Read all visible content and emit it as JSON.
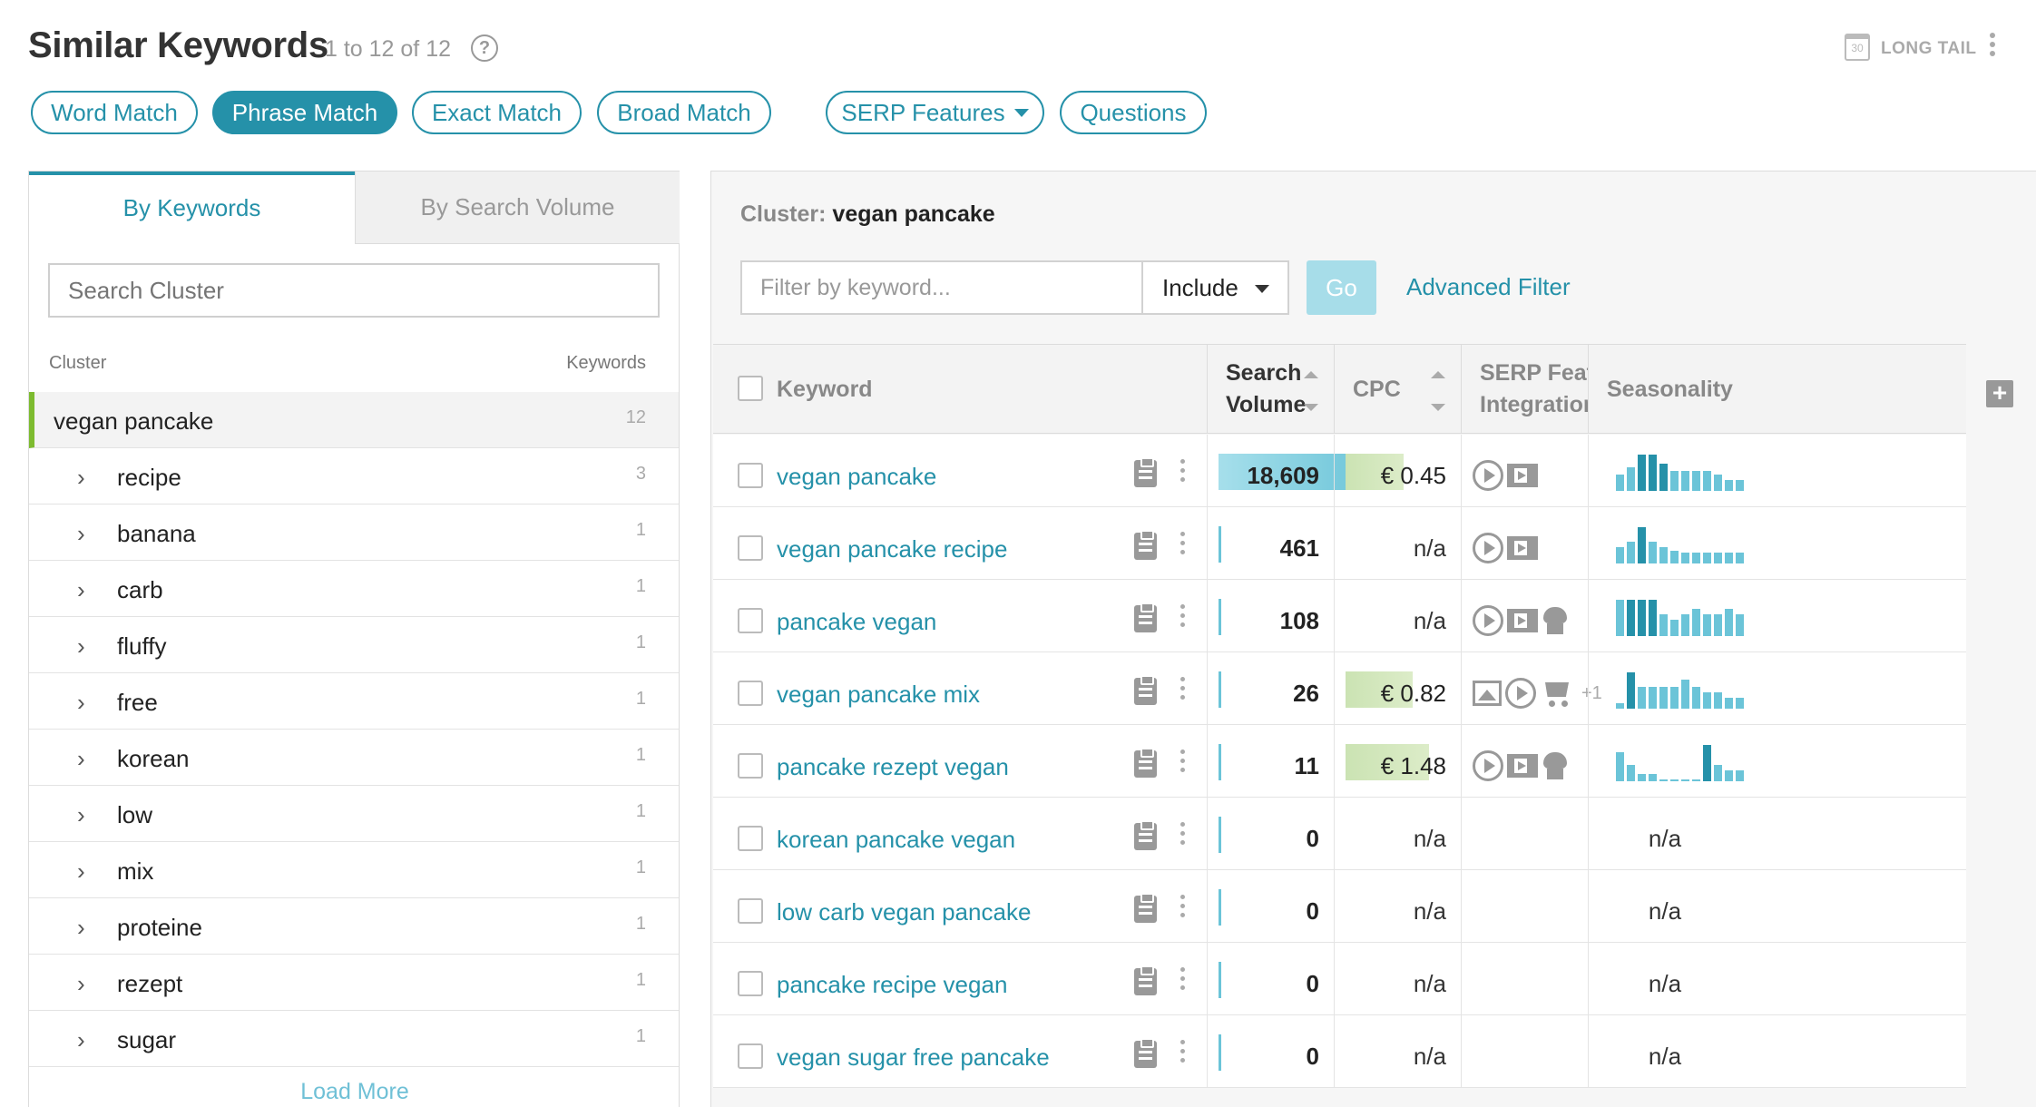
{
  "header": {
    "title": "Similar Keywords",
    "count": "1 to 12 of 12",
    "help": "?",
    "calendar_day": "30",
    "long_tail": "LONG TAIL"
  },
  "match_tabs": [
    "Word Match",
    "Phrase Match",
    "Exact Match",
    "Broad Match"
  ],
  "active_match": "Phrase Match",
  "filter_tabs": [
    "SERP Features",
    "Questions"
  ],
  "left_panel": {
    "tabs": [
      "By Keywords",
      "By Search Volume"
    ],
    "active_tab": "By Keywords",
    "search_placeholder": "Search Cluster",
    "col_cluster": "Cluster",
    "col_keywords": "Keywords",
    "main_cluster": {
      "label": "vegan pancake",
      "count": "12"
    },
    "subclusters": [
      {
        "label": "recipe",
        "count": "3"
      },
      {
        "label": "banana",
        "count": "1"
      },
      {
        "label": "carb",
        "count": "1"
      },
      {
        "label": "fluffy",
        "count": "1"
      },
      {
        "label": "free",
        "count": "1"
      },
      {
        "label": "korean",
        "count": "1"
      },
      {
        "label": "low",
        "count": "1"
      },
      {
        "label": "mix",
        "count": "1"
      },
      {
        "label": "proteine",
        "count": "1"
      },
      {
        "label": "rezept",
        "count": "1"
      },
      {
        "label": "sugar",
        "count": "1"
      }
    ],
    "load_more": "Load More"
  },
  "right_panel": {
    "cluster_label": "Cluster:",
    "cluster_name": "vegan pancake",
    "filter_placeholder": "Filter by keyword...",
    "include_value": "Include",
    "go": "Go",
    "advanced_filter": "Advanced Filter",
    "columns": {
      "keyword": "Keyword",
      "search_volume_1": "Search",
      "search_volume_2": "Volume",
      "cpc": "CPC",
      "serp_1": "SERP Feature",
      "serp_2": "Integrations",
      "seasonality": "Seasonality",
      "add": "+"
    },
    "rows": [
      {
        "keyword": "vegan pancake",
        "volume": "18,609",
        "volume_fraction": 1.0,
        "cpc": "€ 0.45",
        "cpc_fraction": 0.3,
        "serp": [
          "play-icon",
          "video-icon"
        ],
        "season": [
          0.45,
          0.65,
          1.0,
          1.0,
          0.75,
          0.55,
          0.55,
          0.55,
          0.55,
          0.45,
          0.3,
          0.3
        ],
        "season_max": [
          2,
          3,
          4
        ]
      },
      {
        "keyword": "vegan pancake recipe",
        "volume": "461",
        "volume_fraction": 0.0,
        "cpc": "n/a",
        "serp": [
          "play-icon",
          "video-icon"
        ],
        "season": [
          0.45,
          0.6,
          1.0,
          0.6,
          0.45,
          0.35,
          0.3,
          0.3,
          0.3,
          0.3,
          0.3,
          0.3
        ],
        "season_max": [
          2
        ]
      },
      {
        "keyword": "pancake vegan",
        "volume": "108",
        "volume_fraction": 0.0,
        "cpc": "n/a",
        "serp": [
          "play-icon",
          "video-icon",
          "chef-icon"
        ],
        "season": [
          1.0,
          1.0,
          1.0,
          1.0,
          0.6,
          0.45,
          0.6,
          0.75,
          0.6,
          0.6,
          0.75,
          0.6
        ],
        "season_max": [
          1,
          2,
          3
        ]
      },
      {
        "keyword": "vegan pancake mix",
        "volume": "26",
        "volume_fraction": 0.0,
        "cpc": "€ 0.82",
        "cpc_fraction": 0.55,
        "serp": [
          "image-icon",
          "play-icon",
          "cart-icon"
        ],
        "serp_more": "+1",
        "season": [
          0.15,
          1.0,
          0.6,
          0.6,
          0.6,
          0.6,
          0.8,
          0.6,
          0.45,
          0.45,
          0.3,
          0.3
        ],
        "season_max": [
          1
        ]
      },
      {
        "keyword": "pancake rezept vegan",
        "volume": "11",
        "volume_fraction": 0.0,
        "cpc": "€ 1.48",
        "cpc_fraction": 1.0,
        "serp": [
          "play-icon",
          "video-icon",
          "chef-icon"
        ],
        "season": [
          0.8,
          0.45,
          0.2,
          0.2,
          0.0,
          0.0,
          0.0,
          0.0,
          1.0,
          0.45,
          0.3,
          0.3
        ],
        "season_max": [
          8
        ]
      },
      {
        "keyword": "korean pancake vegan",
        "volume": "0",
        "volume_fraction": 0.0,
        "cpc": "n/a",
        "serp": [],
        "season_text": "n/a"
      },
      {
        "keyword": "low carb vegan pancake",
        "volume": "0",
        "volume_fraction": 0.0,
        "cpc": "n/a",
        "serp": [],
        "season_text": "n/a"
      },
      {
        "keyword": "pancake recipe vegan",
        "volume": "0",
        "volume_fraction": 0.0,
        "cpc": "n/a",
        "serp": [],
        "season_text": "n/a"
      },
      {
        "keyword": "vegan sugar free pancake",
        "volume": "0",
        "volume_fraction": 0.0,
        "cpc": "n/a",
        "serp": [],
        "season_text": "n/a"
      }
    ]
  },
  "colors": {
    "accent": "#2591a9",
    "cluster_marker": "#7dbb2f",
    "volume_bar": "#6bc4d8",
    "cpc_bar": "#cbe3b3"
  }
}
